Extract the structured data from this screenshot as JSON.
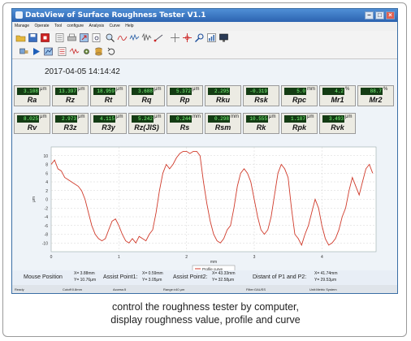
{
  "window": {
    "title": "DataView of Surface Roughness Tester  V1.1"
  },
  "menu": [
    "Manage",
    "Operate",
    "Tool",
    "configure",
    "Analysis",
    "Curve",
    "Help"
  ],
  "datetime": "2017-04-05 14:14:42",
  "row1": [
    {
      "name": "Ra",
      "value": "3.108",
      "unit": "μm"
    },
    {
      "name": "Rz",
      "value": "13.397",
      "unit": "μm"
    },
    {
      "name": "Rt",
      "value": "18.959",
      "unit": "μm"
    },
    {
      "name": "Rq",
      "value": "3.688",
      "unit": "μm"
    },
    {
      "name": "Rp",
      "value": "5.372",
      "unit": "μm"
    },
    {
      "name": "Rku",
      "value": "2.295",
      "unit": ""
    },
    {
      "name": "Rsk",
      "value": "-0.319",
      "unit": ""
    },
    {
      "name": "Rpc",
      "value": "5.0",
      "unit": "mm"
    },
    {
      "name": "Mr1",
      "value": "4.2",
      "unit": "%"
    },
    {
      "name": "Mr2",
      "value": "88.7",
      "unit": "%"
    }
  ],
  "row2": [
    {
      "name": "Rv",
      "value": "8.025",
      "unit": "μm"
    },
    {
      "name": "R3z",
      "value": "2.973",
      "unit": "μm"
    },
    {
      "name": "R3y",
      "value": "4.115",
      "unit": "μm"
    },
    {
      "name": "Rz(JIS)",
      "value": "5.242",
      "unit": "μm"
    },
    {
      "name": "Rs",
      "value": "0.244",
      "unit": "mm"
    },
    {
      "name": "Rsm",
      "value": "0.298",
      "unit": "mm"
    },
    {
      "name": "Rk",
      "value": "10.555",
      "unit": "μm"
    },
    {
      "name": "Rpk",
      "value": "1.187",
      "unit": "μm"
    },
    {
      "name": "Rvk",
      "value": "3.493",
      "unit": "μm"
    }
  ],
  "chart_data": {
    "type": "line",
    "ylabel": "μm",
    "xlabel": "mm",
    "xlim": [
      0,
      4.8
    ],
    "ylim": [
      -12,
      12
    ],
    "yticks": [
      "10",
      "8",
      "6",
      "4",
      "2",
      "0",
      "-2",
      "-4",
      "-6",
      "-8",
      "-10"
    ],
    "xticks": [
      "0",
      "1",
      "2",
      "3",
      "4"
    ],
    "legend": "Profile curve",
    "series": [
      {
        "color": "#d03a2a",
        "x": [
          0.0,
          0.05,
          0.1,
          0.15,
          0.2,
          0.25,
          0.3,
          0.35,
          0.4,
          0.45,
          0.5,
          0.55,
          0.6,
          0.65,
          0.7,
          0.75,
          0.8,
          0.85,
          0.9,
          0.95,
          1.0,
          1.05,
          1.1,
          1.15,
          1.2,
          1.25,
          1.3,
          1.35,
          1.4,
          1.45,
          1.5,
          1.55,
          1.6,
          1.65,
          1.7,
          1.75,
          1.8,
          1.85,
          1.9,
          1.95,
          2.0,
          2.05,
          2.1,
          2.15,
          2.2,
          2.25,
          2.3,
          2.35,
          2.4,
          2.45,
          2.5,
          2.55,
          2.6,
          2.65,
          2.7,
          2.75,
          2.8,
          2.85,
          2.9,
          2.95,
          3.0,
          3.05,
          3.1,
          3.15,
          3.2,
          3.25,
          3.3,
          3.35,
          3.4,
          3.45,
          3.5,
          3.55,
          3.6,
          3.65,
          3.7,
          3.75,
          3.8,
          3.85,
          3.9,
          3.95,
          4.0,
          4.05,
          4.1,
          4.15,
          4.2,
          4.25,
          4.3,
          4.35,
          4.4,
          4.45,
          4.5,
          4.55,
          4.6,
          4.65,
          4.7,
          4.75
        ],
        "y": [
          8,
          9,
          7,
          6.5,
          5,
          4.5,
          4,
          3.5,
          3,
          2,
          0,
          -3,
          -6,
          -8,
          -9,
          -9.5,
          -9,
          -7,
          -5,
          -4.5,
          -6,
          -8,
          -9.5,
          -10,
          -9,
          -10,
          -8.5,
          -9,
          -9.5,
          -8,
          -7,
          -3,
          2,
          6,
          8,
          7,
          8,
          9.5,
          10.5,
          11,
          11,
          10.5,
          11,
          11,
          10,
          4,
          -1,
          -5,
          -8,
          -9.5,
          -10,
          -9,
          -7,
          -6,
          -2,
          3,
          6,
          7,
          6,
          4,
          0,
          -4,
          -7,
          -8,
          -7,
          -4,
          1,
          6,
          8,
          7,
          5,
          -2,
          -8,
          -9,
          -10.5,
          -8,
          -6,
          -3,
          0,
          -2,
          -6,
          -9,
          -10.5,
          -10,
          -9,
          -7,
          -4,
          -2,
          2,
          5,
          3,
          1,
          4,
          7,
          8,
          6
        ]
      }
    ]
  },
  "status": {
    "mouse_label": "Mouse Position",
    "mouse_x": "X= 3.88mm",
    "mouse_y": "Y= 10.76μm",
    "assist1_label": "Assist Point1:",
    "assist1_x": "X= 0.59mm",
    "assist1_y": "Y= 3.05μm",
    "assist2_label": "Assist Point2:",
    "assist2_x": "X= 43.33mm",
    "assist2_y": "Y= 32.58μm",
    "dist_label": "Distant of P1 and P2:",
    "dist_x": "X= 41.74mm",
    "dist_y": "Y= 29.53μm"
  },
  "statusbar": [
    "Ready",
    "Cutoff:0.8mm",
    "Access:5",
    "Range:±40 μm",
    "Filter:GAUSS",
    "Unit:Metric System"
  ],
  "caption": {
    "line1": "control the roughness tester by computer,",
    "line2": "display roughness value, profile and curve"
  }
}
